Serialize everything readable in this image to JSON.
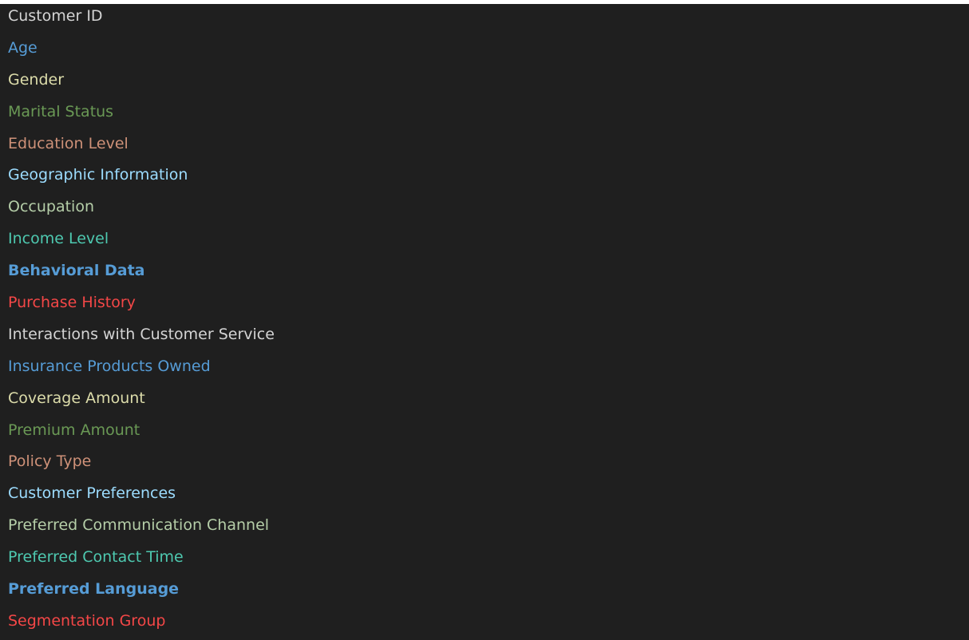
{
  "fields": [
    {
      "label": "Customer ID",
      "color": "#d4d4d4",
      "bold": false
    },
    {
      "label": "Age",
      "color": "#569cd6",
      "bold": false
    },
    {
      "label": "Gender",
      "color": "#dcdcaa",
      "bold": false
    },
    {
      "label": "Marital Status",
      "color": "#6a9955",
      "bold": false
    },
    {
      "label": "Education Level",
      "color": "#ce9178",
      "bold": false
    },
    {
      "label": "Geographic Information",
      "color": "#9cdcfe",
      "bold": false
    },
    {
      "label": "Occupation",
      "color": "#b5cea8",
      "bold": false
    },
    {
      "label": "Income Level",
      "color": "#4ec9b0",
      "bold": false
    },
    {
      "label": "Behavioral Data",
      "color": "#569cd6",
      "bold": true
    },
    {
      "label": "Purchase History",
      "color": "#f44747",
      "bold": false
    },
    {
      "label": "Interactions with Customer Service",
      "color": "#d4d4d4",
      "bold": false
    },
    {
      "label": "Insurance Products Owned",
      "color": "#569cd6",
      "bold": false
    },
    {
      "label": "Coverage Amount",
      "color": "#dcdcaa",
      "bold": false
    },
    {
      "label": "Premium Amount",
      "color": "#6a9955",
      "bold": false
    },
    {
      "label": "Policy Type",
      "color": "#ce9178",
      "bold": false
    },
    {
      "label": "Customer Preferences",
      "color": "#9cdcfe",
      "bold": false
    },
    {
      "label": "Preferred Communication Channel",
      "color": "#b5cea8",
      "bold": false
    },
    {
      "label": "Preferred Contact Time",
      "color": "#4ec9b0",
      "bold": false
    },
    {
      "label": "Preferred Language",
      "color": "#569cd6",
      "bold": true
    },
    {
      "label": "Segmentation Group",
      "color": "#f44747",
      "bold": false
    }
  ]
}
